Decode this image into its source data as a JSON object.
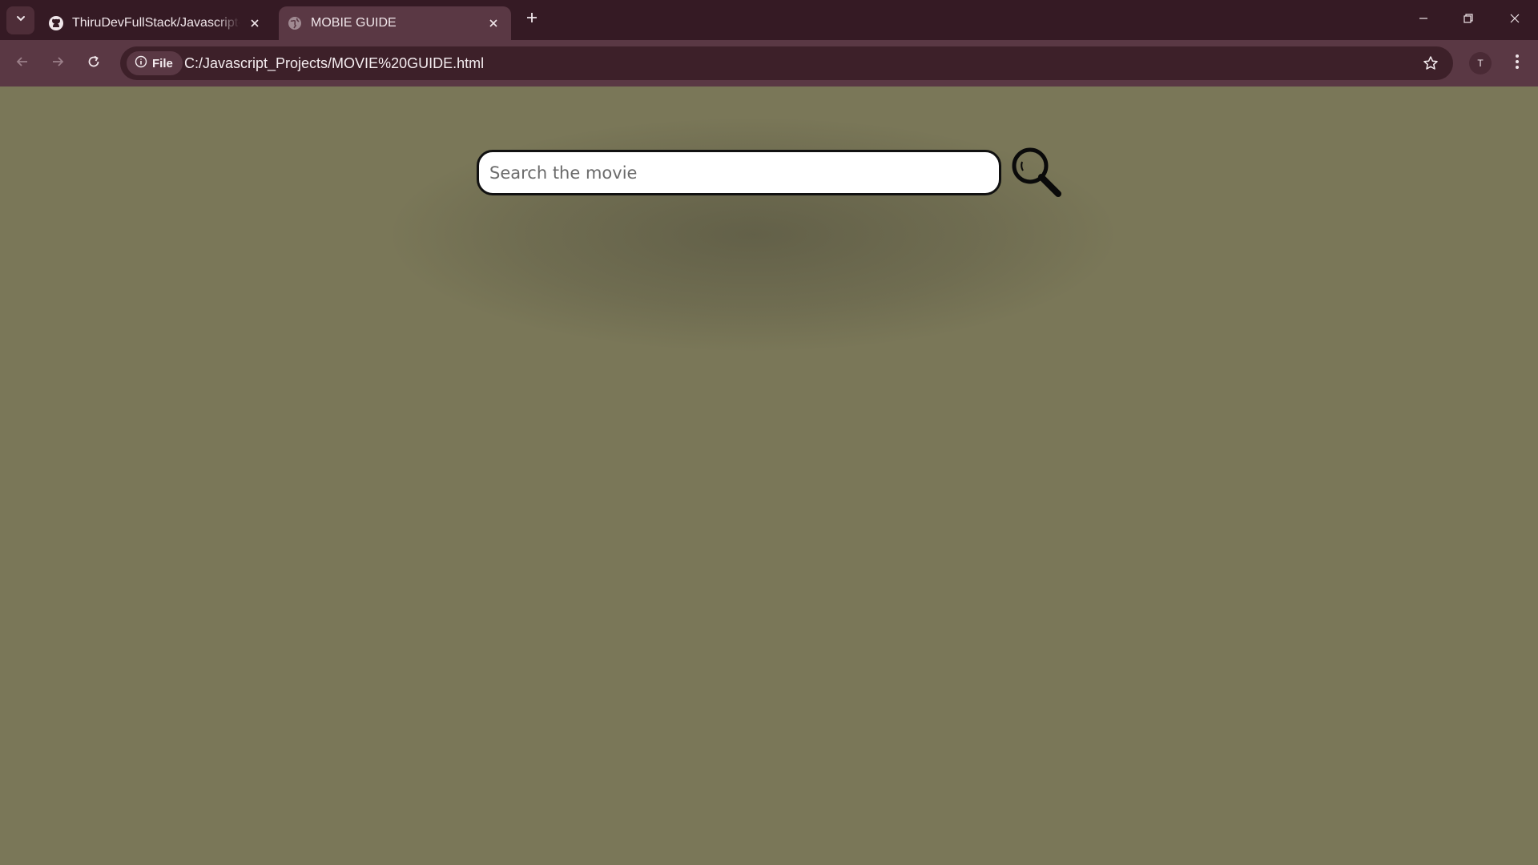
{
  "browser": {
    "tabs": [
      {
        "title": "ThiruDevFullStack/Javascript-pr",
        "favicon": "github-icon",
        "active": false
      },
      {
        "title": "MOBIE GUIDE",
        "favicon": "globe-icon",
        "active": true
      }
    ],
    "address_bar": {
      "chip_label": "File",
      "url": "C:/Javascript_Projects/MOVIE%20GUIDE.html"
    },
    "profile_initial": "T"
  },
  "page": {
    "search": {
      "placeholder": "Search the movie",
      "value": ""
    }
  },
  "colors": {
    "page_background": "#7a7758",
    "tabstrip": "#351a24",
    "toolbar": "#5a3844"
  }
}
